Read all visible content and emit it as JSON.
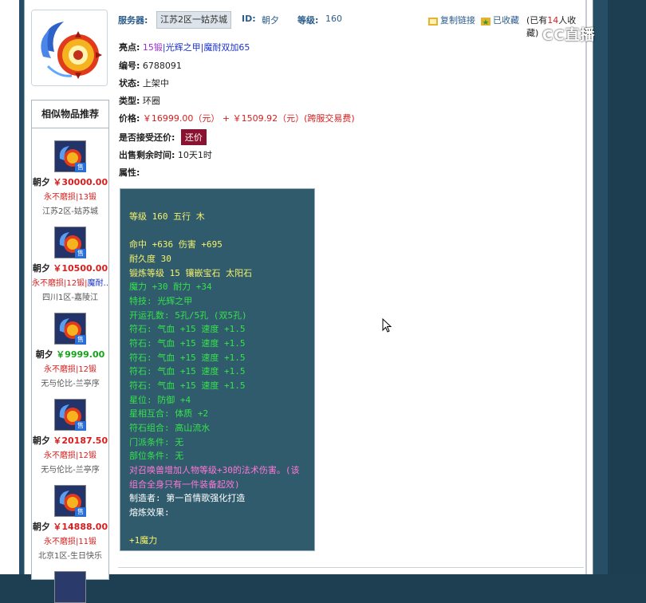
{
  "header": {
    "server_label": "服务器:",
    "server_value": "江苏2区一姑苏城",
    "id_label": "ID:",
    "id_value": "朝夕",
    "level_label": "等级:",
    "level_value": "160",
    "copy_link": "复制链接",
    "favorited": "已收藏",
    "fav_count_prefix": "(已有",
    "fav_count": "14",
    "fav_count_suffix": "人收藏)"
  },
  "watermark": "CC直播",
  "details": {
    "highlight_label": "亮点:",
    "highlight_items": [
      "15锻",
      "光辉之甲",
      "魔耐双加65"
    ],
    "number_label": "编号:",
    "number_value": "6788091",
    "status_label": "状态:",
    "status_value": "上架中",
    "type_label": "类型:",
    "type_value": "环圈",
    "price_label": "价格:",
    "price_value": "￥16999.00（元）",
    "price_plus": "+",
    "fee_value": "￥1509.92（元）(跨服交易费)",
    "counter_label": "是否接受还价:",
    "counter_button": "还价",
    "remaining_label": "出售剩余时间:",
    "remaining_value": "10天1时",
    "attr_label": "属性:"
  },
  "attributes": [
    {
      "text": "等级 160 五行 木",
      "color": "y"
    },
    {
      "text": "命中 +636 伤害 +695",
      "color": "y"
    },
    {
      "text": "耐久度 30",
      "color": "y"
    },
    {
      "text": "锻炼等级 15 镶嵌宝石 太阳石",
      "color": "y"
    },
    {
      "text": "魔力 +30 耐力 +34",
      "color": "g"
    },
    {
      "text": "特技: 光辉之甲",
      "color": "g"
    },
    {
      "text": "开运孔数: 5孔/5孔 (双5孔)",
      "color": "g"
    },
    {
      "text": "符石: 气血 +15 速度 +1.5",
      "color": "g"
    },
    {
      "text": "符石: 气血 +15 速度 +1.5",
      "color": "g"
    },
    {
      "text": "符石: 气血 +15 速度 +1.5",
      "color": "g"
    },
    {
      "text": "符石: 气血 +15 速度 +1.5",
      "color": "g"
    },
    {
      "text": "符石: 气血 +15 速度 +1.5",
      "color": "g"
    },
    {
      "text": "星位: 防御 +4",
      "color": "g"
    },
    {
      "text": "星相互合: 体质 +2",
      "color": "g"
    },
    {
      "text": "符石组合: 高山流水",
      "color": "g"
    },
    {
      "text": "门派条件: 无",
      "color": "g"
    },
    {
      "text": "部位条件: 无",
      "color": "g"
    },
    {
      "text": "对召唤兽增加人物等级+30的法术伤害。(该",
      "color": "m"
    },
    {
      "text": "组合全身只有一件装备起效)",
      "color": "m"
    },
    {
      "text": "制造者: 第一首情歌强化打造",
      "color": "w"
    },
    {
      "text": "熔炼效果:",
      "color": "w"
    },
    {
      "text": "+1魔力",
      "color": "y"
    }
  ],
  "sidebar": {
    "title": "相似物品推荐",
    "items": [
      {
        "name": "朝夕",
        "price": "￥30000.00",
        "tags": "永不磨损|13锻",
        "server": "江苏2区-姑苏城"
      },
      {
        "name": "朝夕",
        "price": "￥10500.00",
        "tags": "永不磨损|12锻|",
        "extra": "魔耐…",
        "server": "四川1区-嘉陵江"
      },
      {
        "name": "朝夕",
        "price": "￥9999.00",
        "tags": "永不磨损|12锻",
        "server": "无与伦比-兰亭序"
      },
      {
        "name": "朝夕",
        "price": "￥20187.50",
        "tags": "永不磨损|12锻",
        "server": "无与伦比-兰亭序"
      },
      {
        "name": "朝夕",
        "price": "￥14888.00",
        "tags": "永不磨损|11锻",
        "server": "北京1区-生日快乐"
      }
    ],
    "sell_badge": "售"
  },
  "colors": {
    "accent_blue": "#2b5c8c",
    "price_red": "#d81e1e",
    "attr_bg": "#2f5b6d",
    "counter_btn": "#8a1230"
  }
}
